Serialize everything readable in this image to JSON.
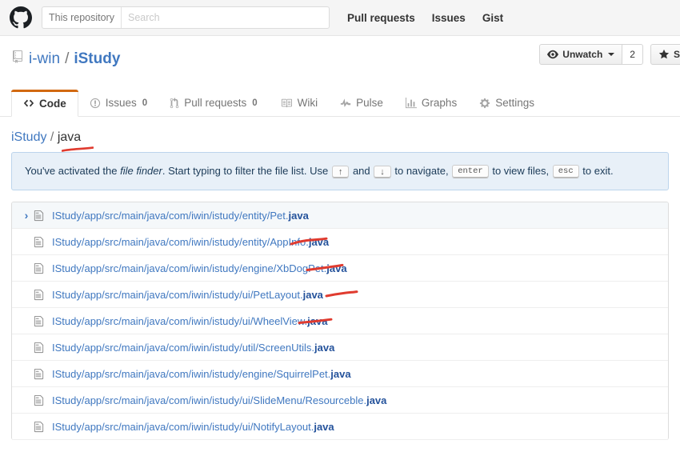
{
  "topnav": {
    "logo_icon": "github-mark-icon",
    "search": {
      "scope_label": "This repository",
      "placeholder": "Search",
      "value": ""
    },
    "links": [
      {
        "label": "Pull requests",
        "name": "pull-requests"
      },
      {
        "label": "Issues",
        "name": "issues"
      },
      {
        "label": "Gist",
        "name": "gist"
      }
    ]
  },
  "repo": {
    "icon": "repo-icon",
    "owner": "i-win",
    "separator": "/",
    "name": "iStudy",
    "actions": {
      "watch_label": "Unwatch",
      "watch_icon": "eye-icon",
      "watch_count": "2",
      "star_label": "S",
      "star_icon": "star-icon"
    }
  },
  "tabs": [
    {
      "label": "Code",
      "icon": "code-icon",
      "count": "",
      "active": true
    },
    {
      "label": "Issues",
      "icon": "issue-opened-icon",
      "count": "0",
      "active": false
    },
    {
      "label": "Pull requests",
      "icon": "git-pull-request-icon",
      "count": "0",
      "active": false
    },
    {
      "label": "Wiki",
      "icon": "book-icon",
      "count": "",
      "active": false
    },
    {
      "label": "Pulse",
      "icon": "pulse-icon",
      "count": "",
      "active": false
    },
    {
      "label": "Graphs",
      "icon": "graph-icon",
      "count": "",
      "active": false
    },
    {
      "label": "Settings",
      "icon": "gear-icon",
      "count": "",
      "active": false
    }
  ],
  "breadcrumb": {
    "root": "iStudy",
    "separator": "/",
    "current": "java"
  },
  "flash": {
    "text_1": "You've activated the ",
    "emphasis": "file finder",
    "text_2": ". Start typing to filter the file list. Use ",
    "key_up": "↑",
    "text_3": " and ",
    "key_down": "↓",
    "text_4": " to navigate, ",
    "key_enter": "enter",
    "text_5": " to view files, ",
    "key_esc": "esc",
    "text_6": " to exit."
  },
  "file_list": {
    "selected_index": 0,
    "rows": [
      {
        "path": "IStudy/app/src/main/java/com/iwin/istudy/entity/Pet",
        "ext": "java",
        "selected": true
      },
      {
        "path": "IStudy/app/src/main/java/com/iwin/istudy/entity/AppInfo",
        "ext": "java",
        "selected": false
      },
      {
        "path": "IStudy/app/src/main/java/com/iwin/istudy/engine/XbDogPet",
        "ext": "java",
        "selected": false
      },
      {
        "path": "IStudy/app/src/main/java/com/iwin/istudy/ui/PetLayout",
        "ext": "java",
        "selected": false
      },
      {
        "path": "IStudy/app/src/main/java/com/iwin/istudy/ui/WheelView",
        "ext": "java",
        "selected": false
      },
      {
        "path": "IStudy/app/src/main/java/com/iwin/istudy/util/ScreenUtils",
        "ext": "java",
        "selected": false
      },
      {
        "path": "IStudy/app/src/main/java/com/iwin/istudy/engine/SquirrelPet",
        "ext": "java",
        "selected": false
      },
      {
        "path": "IStudy/app/src/main/java/com/iwin/istudy/ui/SlideMenu/Resourceble",
        "ext": "java",
        "selected": false
      },
      {
        "path": "IStudy/app/src/main/java/com/iwin/istudy/ui/NotifyLayout",
        "ext": "java",
        "selected": false
      }
    ]
  },
  "annotations": {
    "color": "#e03b2f",
    "marks": [
      {
        "name": "underline-breadcrumb-java"
      },
      {
        "name": "underline-row-1-java"
      },
      {
        "name": "underline-row-2-java"
      },
      {
        "name": "underline-row-3-java"
      },
      {
        "name": "underline-row-4-java"
      }
    ]
  },
  "colors": {
    "link": "#4078c0",
    "active_tab_bar": "#d26911",
    "flash_bg": "#e8f0f8",
    "annotation_red": "#e03b2f"
  }
}
